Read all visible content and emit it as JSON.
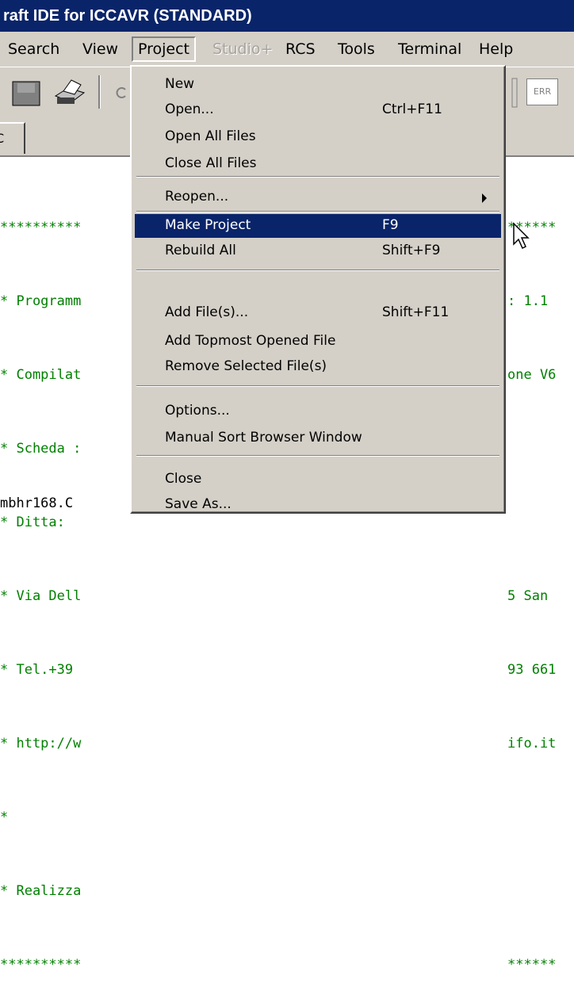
{
  "window": {
    "title": "raft IDE for ICCAVR (STANDARD)"
  },
  "menubar": [
    {
      "label": "Search",
      "state": "normal"
    },
    {
      "label": "View",
      "state": "normal"
    },
    {
      "label": "Project",
      "state": "pressed"
    },
    {
      "label": "Studio+",
      "state": "disabled"
    },
    {
      "label": "RCS",
      "state": "normal"
    },
    {
      "label": "Tools",
      "state": "normal"
    },
    {
      "label": "Terminal",
      "state": "normal"
    },
    {
      "label": "Help",
      "state": "normal"
    }
  ],
  "toolbar": {
    "icons": [
      "save-icon",
      "print-icon",
      "undo-icon",
      "error-icon"
    ],
    "err_label": "ERR"
  },
  "tab": {
    "label": "C"
  },
  "editor": {
    "left_lines": [
      "**********",
      "* Programm",
      "* Compilat",
      "* Scheda :",
      "* Ditta:",
      "* Via Dell",
      "* Tel.+39",
      "* http://w",
      "*",
      "* Realizza",
      "**********"
    ],
    "right_lines": [
      "******",
      ": 1.1",
      "one V6",
      "",
      "",
      "5 San",
      "93 661",
      "ifo.it",
      "",
      "",
      "******"
    ],
    "filename": "mbhr168.C"
  },
  "project_menu": {
    "groups": [
      [
        {
          "label": "New",
          "shortcut": ""
        },
        {
          "label": "Open...",
          "shortcut": "Ctrl+F11"
        },
        {
          "label": "Open All Files",
          "shortcut": ""
        },
        {
          "label": "Close All Files",
          "shortcut": ""
        }
      ],
      [
        {
          "label": "Reopen...",
          "shortcut": "",
          "submenu": true
        }
      ],
      [
        {
          "label": "Make Project",
          "shortcut": "F9",
          "highlighted": true
        },
        {
          "label": "Rebuild All",
          "shortcut": "Shift+F9"
        }
      ],
      [
        {
          "label": "Add File(s)...",
          "shortcut": "Shift+F11"
        },
        {
          "label": "Add Topmost Opened File",
          "shortcut": ""
        },
        {
          "label": "Remove Selected File(s)",
          "shortcut": ""
        }
      ],
      [
        {
          "label": "Options...",
          "shortcut": ""
        },
        {
          "label": "Manual Sort Browser Window",
          "shortcut": ""
        }
      ],
      [
        {
          "label": "Close",
          "shortcut": ""
        },
        {
          "label": "Save As...",
          "shortcut": ""
        }
      ]
    ]
  },
  "colors": {
    "title_bg": "#0a246a",
    "face": "#d4d0c8",
    "code": "#008000",
    "highlight": "#0a246a"
  }
}
